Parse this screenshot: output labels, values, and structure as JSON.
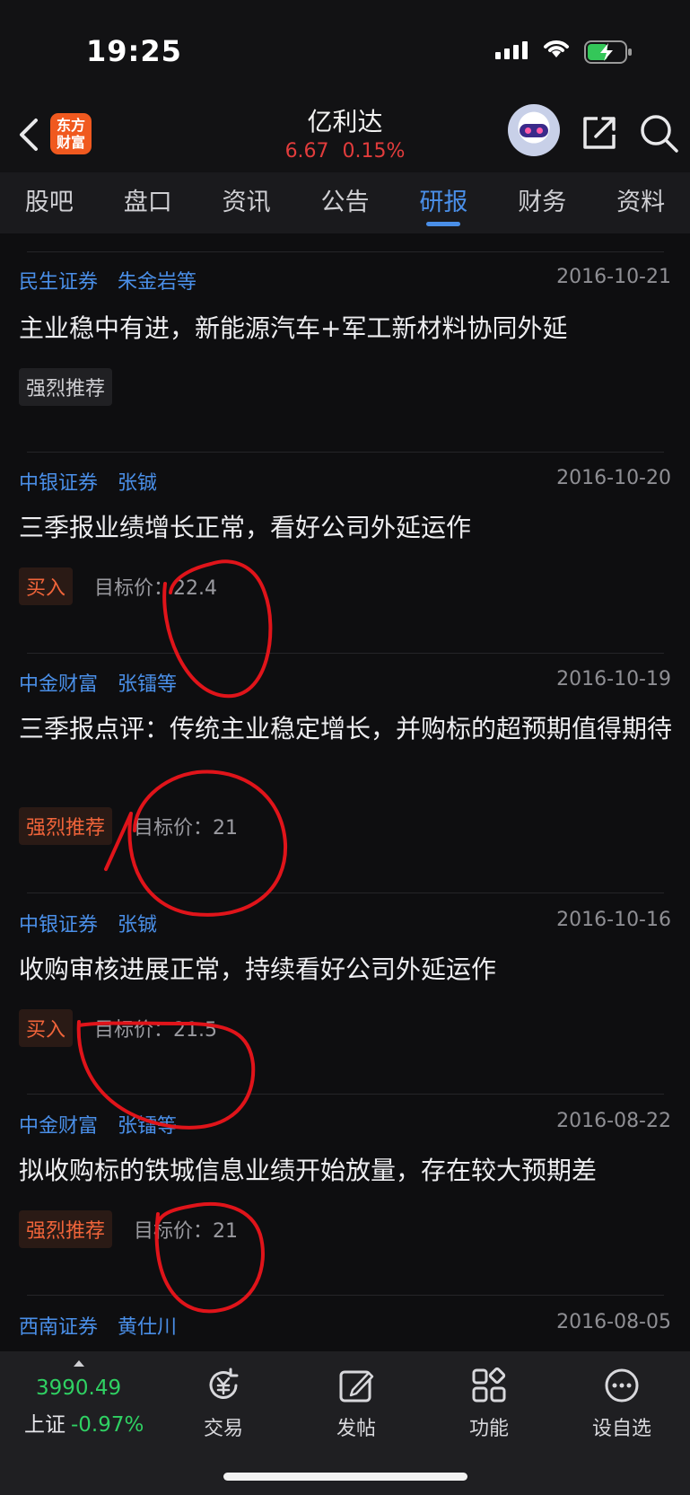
{
  "status": {
    "time": "19:25"
  },
  "header": {
    "logo_line1": "东方",
    "logo_line2": "财富",
    "title": "亿利达",
    "price": "6.67",
    "change_pct": "0.15%"
  },
  "tabs": [
    {
      "label": "股吧"
    },
    {
      "label": "盘口"
    },
    {
      "label": "资讯"
    },
    {
      "label": "公告"
    },
    {
      "label": "研报",
      "active": true
    },
    {
      "label": "财务"
    },
    {
      "label": "资料"
    }
  ],
  "reports": [
    {
      "broker": "民生证券",
      "author": "朱金岩等",
      "date": "2016-10-21",
      "title": "主业稳中有进，新能源汽车+军工新材料协同外延",
      "rating": "强烈推荐",
      "rating_color": "gray",
      "target": ""
    },
    {
      "broker": "中银证券",
      "author": "张铖",
      "date": "2016-10-20",
      "title": "三季报业绩增长正常，看好公司外延运作",
      "rating": "买入",
      "rating_color": "orange",
      "target": "目标价：22.4"
    },
    {
      "broker": "中金财富",
      "author": "张镭等",
      "date": "2016-10-19",
      "title": "三季报点评：传统主业稳定增长，并购标的超预期值得期待",
      "rating": "强烈推荐",
      "rating_color": "orange",
      "target": "目标价：21"
    },
    {
      "broker": "中银证券",
      "author": "张铖",
      "date": "2016-10-16",
      "title": "收购审核进展正常，持续看好公司外延运作",
      "rating": "买入",
      "rating_color": "orange",
      "target": "目标价：21.5"
    },
    {
      "broker": "中金财富",
      "author": "张镭等",
      "date": "2016-08-22",
      "title": "拟收购标的铁城信息业绩开始放量，存在较大预期差",
      "rating": "强烈推荐",
      "rating_color": "orange",
      "target": "目标价：21"
    },
    {
      "broker": "西南证券",
      "author": "黄仕川",
      "date": "2016-08-05",
      "title": "",
      "rating": "",
      "rating_color": "gray",
      "target": ""
    }
  ],
  "bottom": {
    "index_value": "3990.49",
    "index_name": "上证",
    "index_change": "-0.97%",
    "nav": [
      {
        "label": "交易",
        "icon": "yen-cycle-icon"
      },
      {
        "label": "发帖",
        "icon": "edit-icon"
      },
      {
        "label": "功能",
        "icon": "grid-icon"
      },
      {
        "label": "设自选",
        "icon": "more-icon"
      }
    ]
  },
  "colors": {
    "accent": "#4a8fe8",
    "up": "#e23c3c",
    "down": "#2fd163",
    "rating_orange": "#f0643a",
    "annotation": "#e0141a"
  }
}
